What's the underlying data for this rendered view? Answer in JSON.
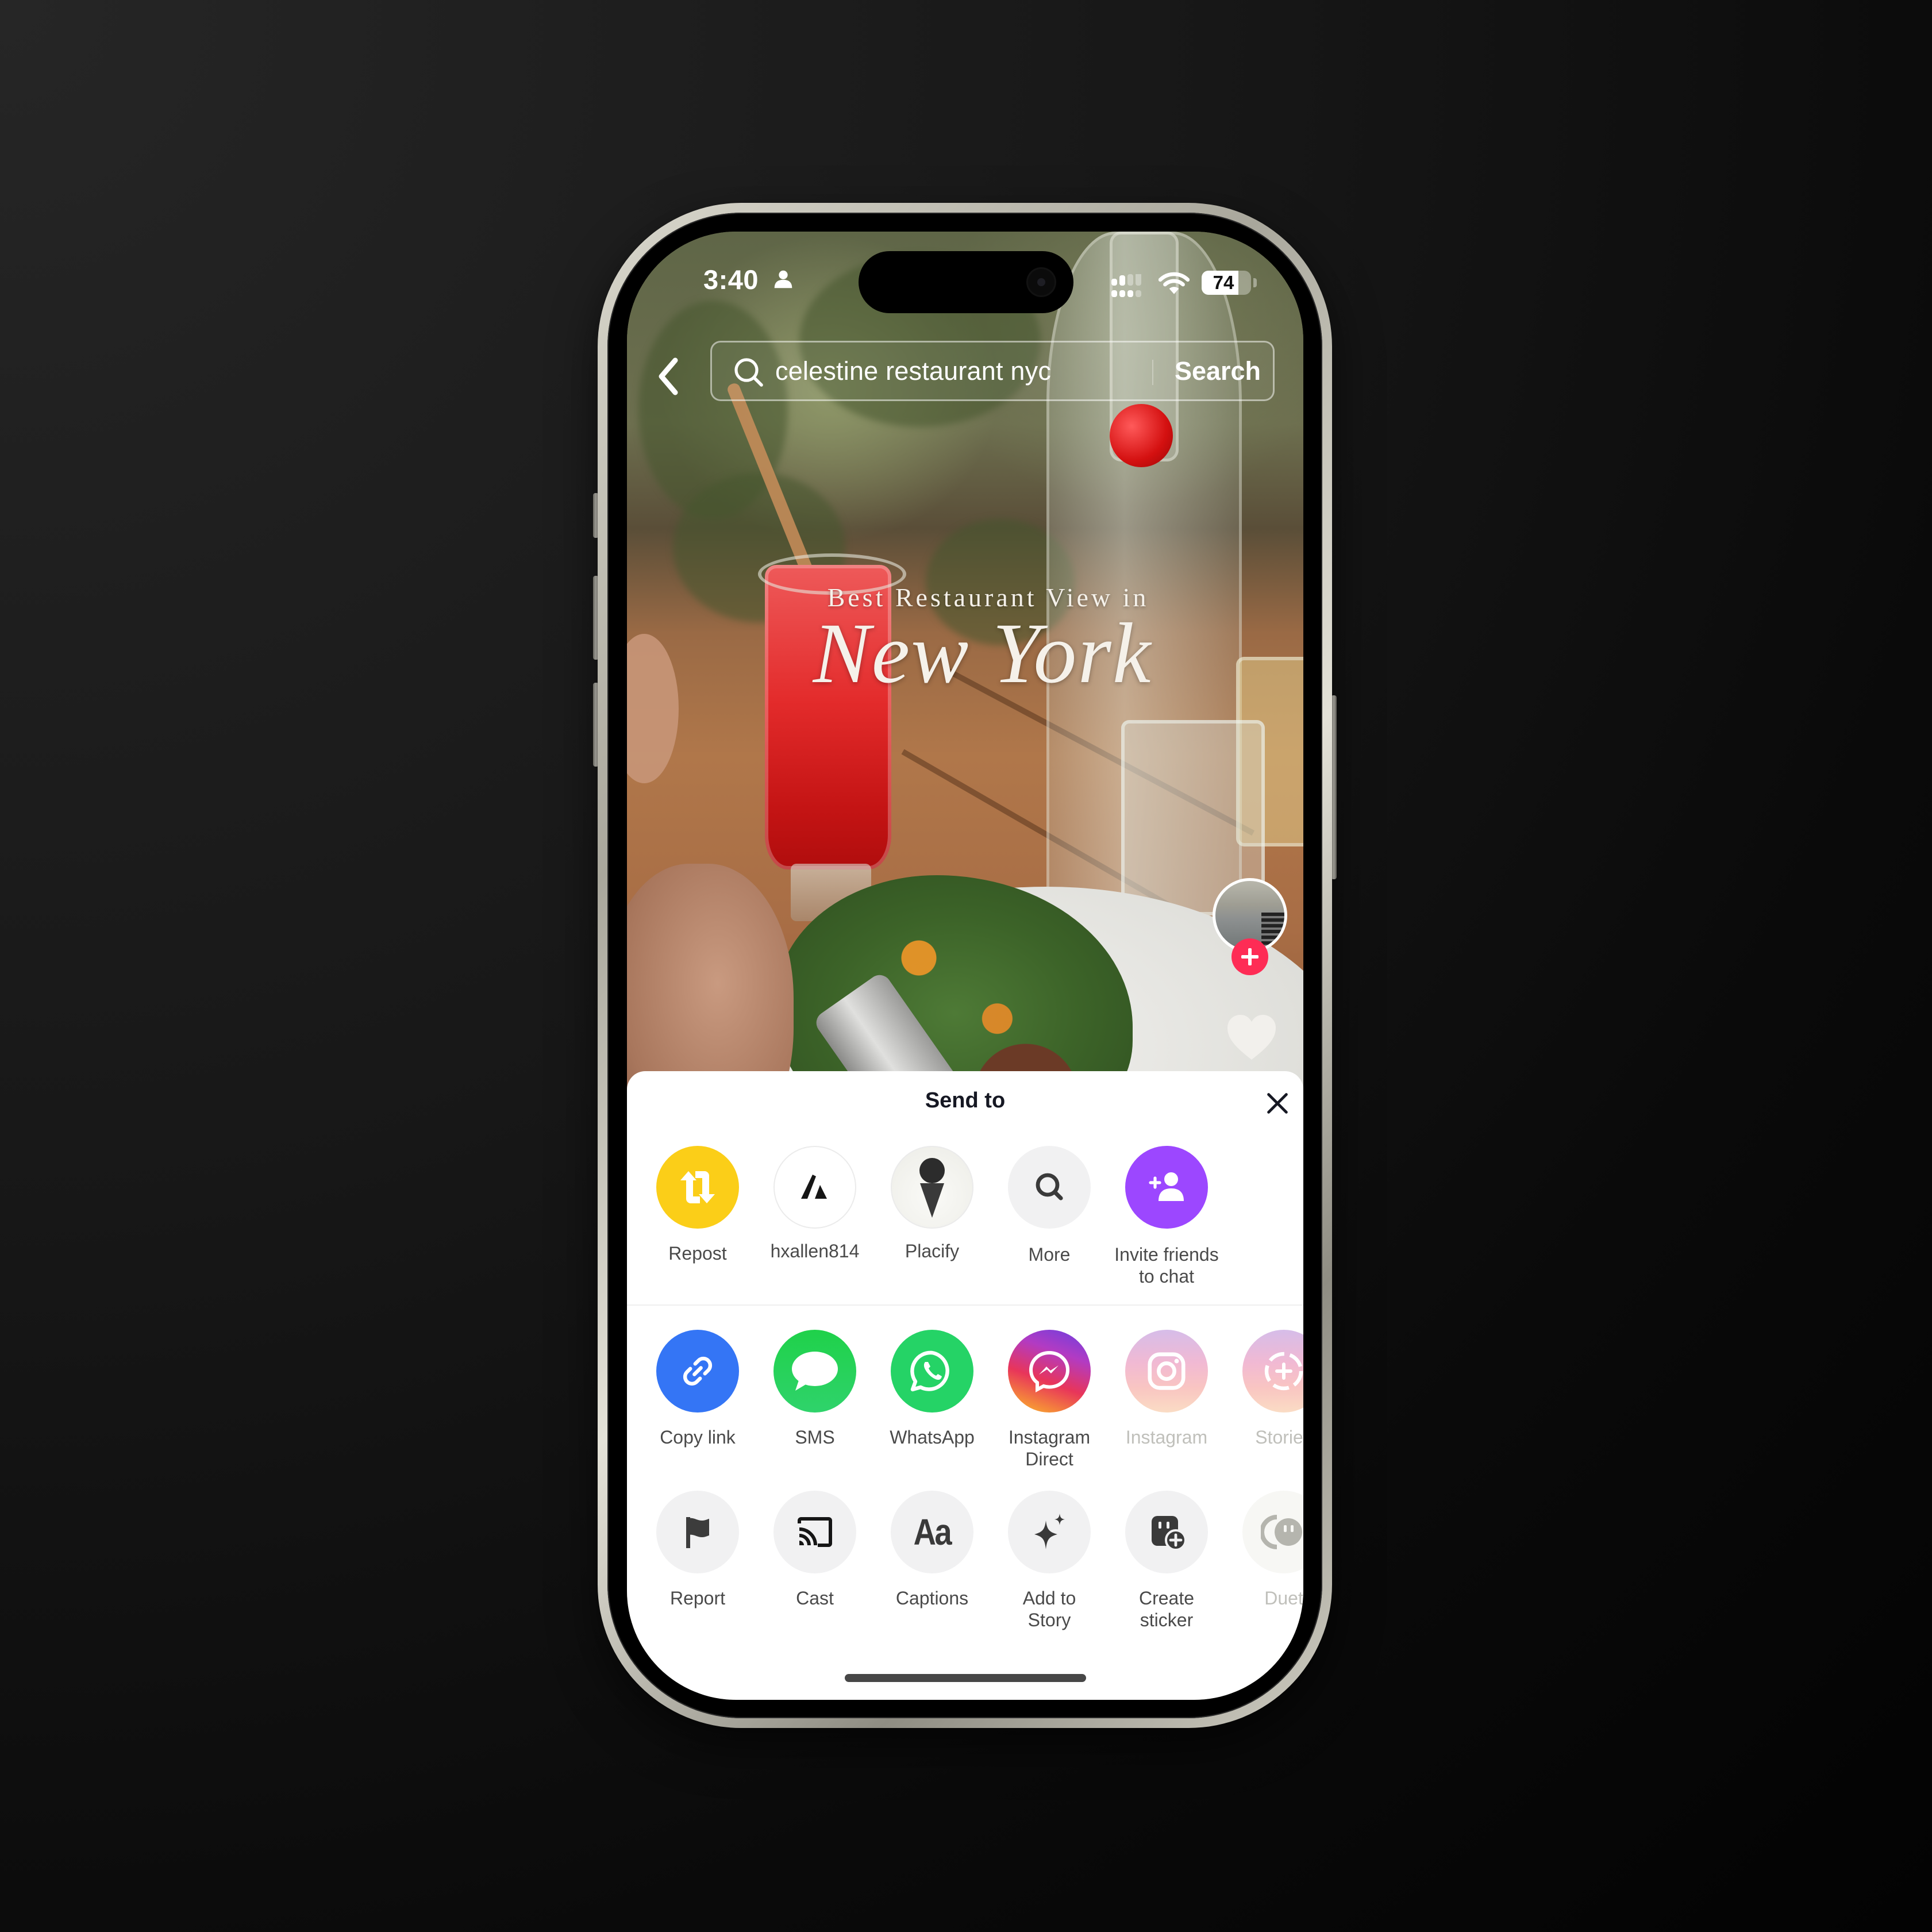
{
  "status_bar": {
    "time": "3:40",
    "battery_percent": "74",
    "battery_level": 0.74
  },
  "search": {
    "query": "celestine restaurant nyc",
    "button_label": "Search"
  },
  "video": {
    "overlay_line1": "Best Restaurant View in",
    "overlay_line2": "New York"
  },
  "colors": {
    "follow_accent": "#fe2c55",
    "repost": "#fbce18",
    "invite": "#9c47ff",
    "copy_link": "#3475f5",
    "sms": "#28d15b",
    "whatsapp": "#25d366"
  },
  "share_sheet": {
    "title": "Send to",
    "contacts": [
      {
        "label": "Repost",
        "icon": "repost-icon"
      },
      {
        "label": "hxallen814",
        "icon": "avatar-logo-icon"
      },
      {
        "label": "Placify",
        "icon": "map-pin-icon"
      },
      {
        "label": "More",
        "icon": "search-icon"
      },
      {
        "label": "Invite friends\nto chat",
        "icon": "add-user-icon"
      }
    ],
    "share_apps": [
      {
        "label": "Copy link",
        "icon": "link-icon"
      },
      {
        "label": "SMS",
        "icon": "message-bubble-icon"
      },
      {
        "label": "WhatsApp",
        "icon": "whatsapp-icon"
      },
      {
        "label": "Instagram\nDirect",
        "icon": "messenger-icon"
      },
      {
        "label": "Instagram",
        "icon": "instagram-icon",
        "disabled": true
      },
      {
        "label": "Stories",
        "icon": "story-add-icon",
        "disabled": true
      }
    ],
    "actions": [
      {
        "label": "Report",
        "icon": "flag-icon"
      },
      {
        "label": "Cast",
        "icon": "cast-icon"
      },
      {
        "label": "Captions",
        "icon": "captions-icon"
      },
      {
        "label": "Add to\nStory",
        "icon": "sparkle-icon"
      },
      {
        "label": "Create\nsticker",
        "icon": "sticker-add-icon"
      },
      {
        "label": "Duet",
        "icon": "duet-icon",
        "disabled": true
      }
    ]
  }
}
